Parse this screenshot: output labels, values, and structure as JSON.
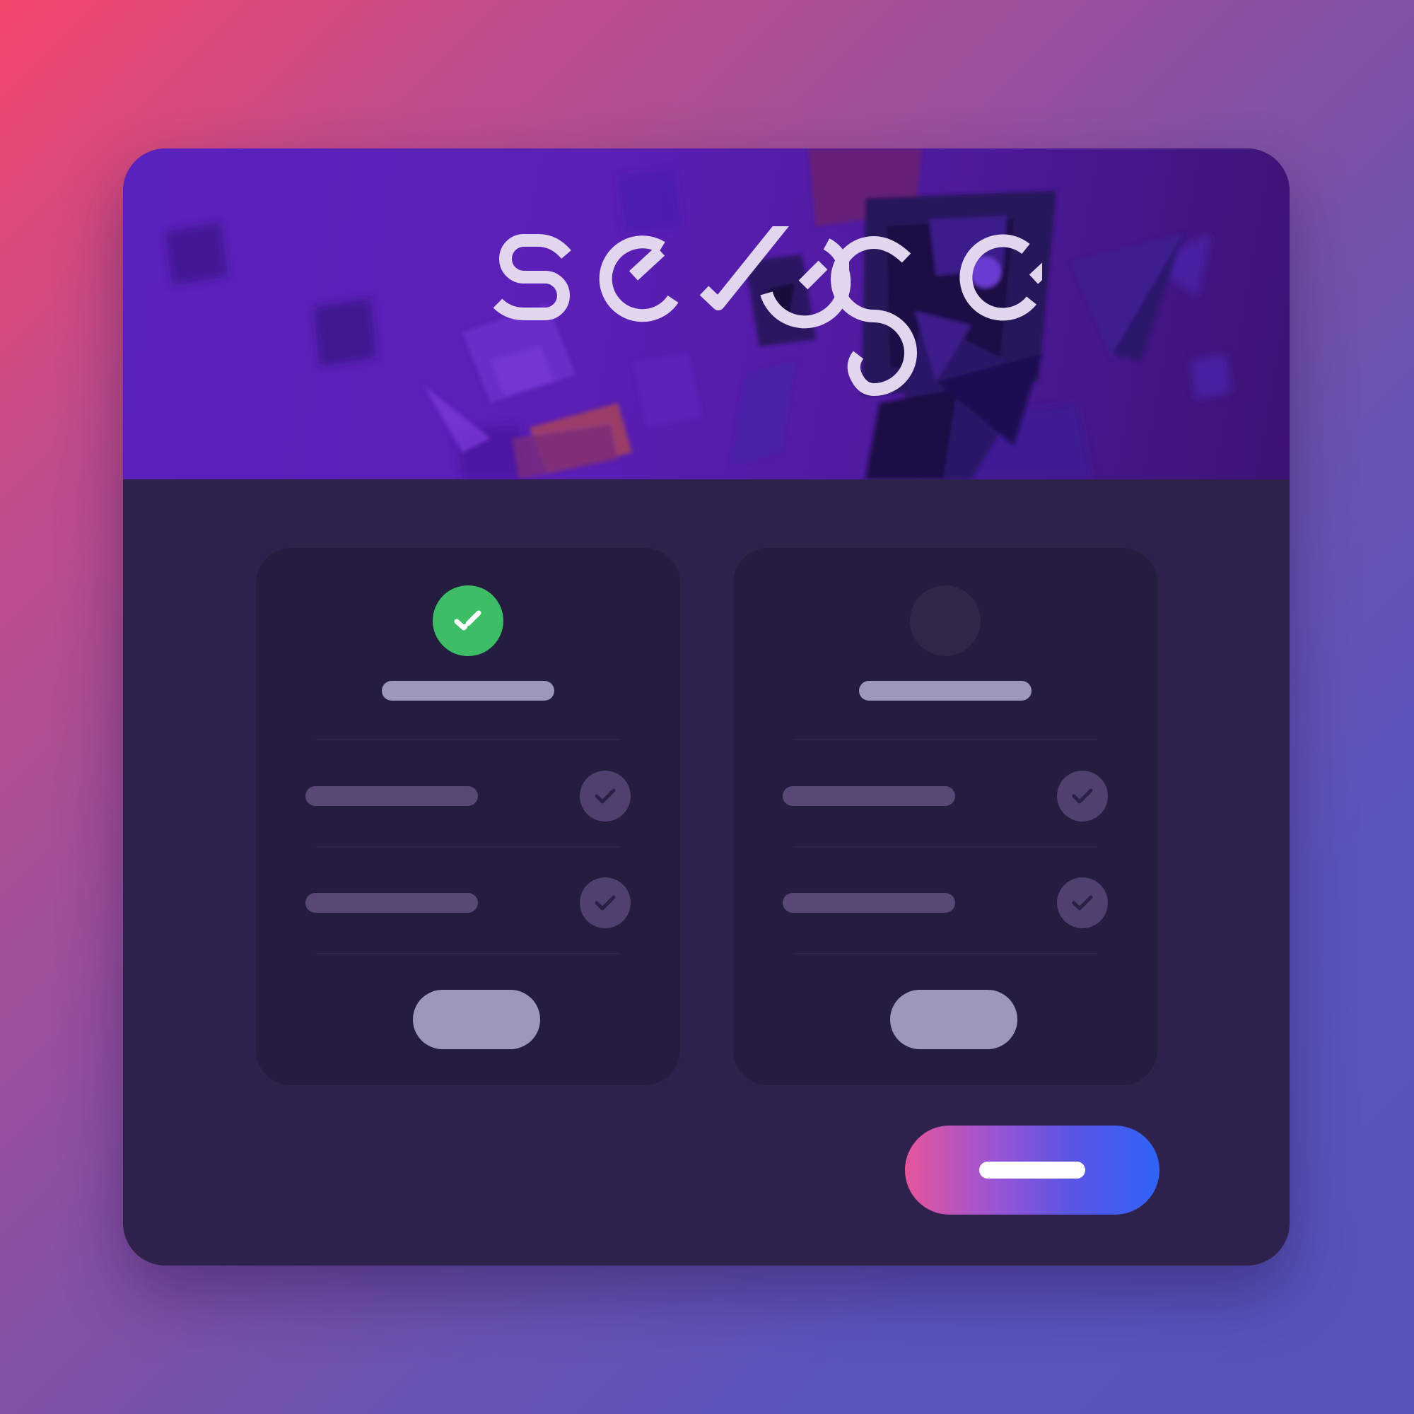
{
  "app": {
    "brand_name": "sexygen"
  },
  "colors": {
    "selected_status": "#3dbd66",
    "unselected_status": "#2f2747",
    "card_background": "#251d3f",
    "window_background": "#2e224c",
    "cta_gradient": [
      "#e5559b",
      "#9b55d3",
      "#5b55e5",
      "#2f63f7"
    ]
  },
  "plans": [
    {
      "selected": true,
      "status_icon": "check-icon",
      "features": [
        {
          "icon": "check-icon"
        },
        {
          "icon": "check-icon"
        }
      ]
    },
    {
      "selected": false,
      "status_icon": "empty-circle",
      "features": [
        {
          "icon": "check-icon"
        },
        {
          "icon": "check-icon"
        }
      ]
    }
  ],
  "primary_action": {
    "icon": "placeholder-label"
  }
}
